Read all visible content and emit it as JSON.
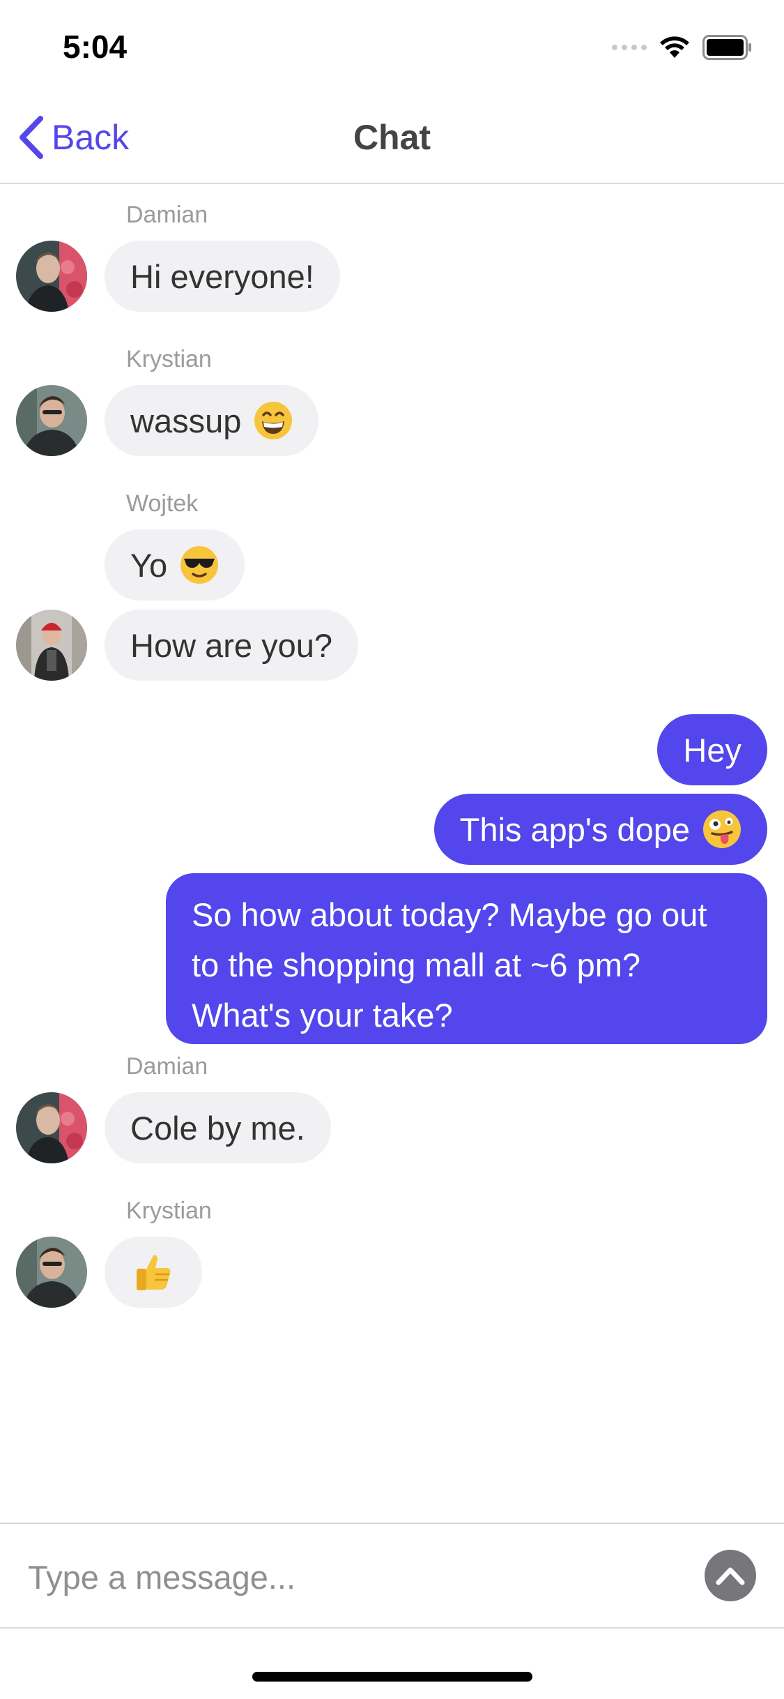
{
  "status_bar": {
    "time": "5:04",
    "icons": [
      "cellular-signal-icon",
      "wifi-icon",
      "battery-icon"
    ]
  },
  "nav": {
    "back_label": "Back",
    "title": "Chat",
    "accent_color": "#5546e9"
  },
  "messages": [
    {
      "sender": "Damian",
      "text": "Hi everyone!",
      "outgoing": false
    },
    {
      "sender": "Krystian",
      "text": "wassup",
      "emoji": "grinning-face-icon",
      "outgoing": false
    },
    {
      "sender": "Wojtek",
      "text": "Yo",
      "emoji": "sunglasses-face-icon",
      "outgoing": false
    },
    {
      "sender": "Wojtek",
      "text": "How are you?",
      "outgoing": false
    },
    {
      "text": "Hey",
      "outgoing": true
    },
    {
      "text": "This app's dope",
      "emoji": "zany-face-icon",
      "outgoing": true
    },
    {
      "text": "So how about today? Maybe go out to the shopping mall at ~6 pm? What's your take?",
      "outgoing": true
    },
    {
      "sender": "Damian",
      "text": "Cole by me.",
      "outgoing": false
    },
    {
      "sender": "Krystian",
      "text": "",
      "emoji": "thumbs-up-icon",
      "outgoing": false
    }
  ],
  "colors": {
    "outgoing_bubble": "#5246ec",
    "incoming_bubble": "#f1f1f4"
  },
  "composer": {
    "placeholder": "Type a message...",
    "value": ""
  }
}
